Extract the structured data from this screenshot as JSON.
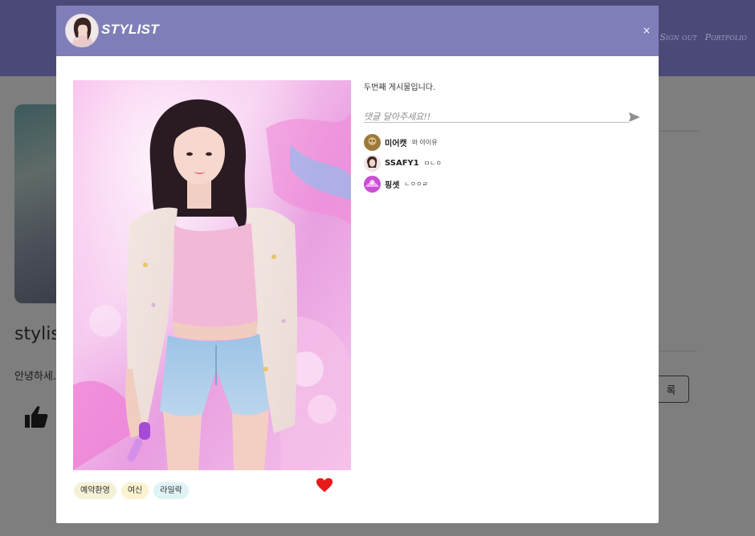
{
  "background": {
    "nav_links": [
      "Sign out",
      "Portfolio"
    ],
    "profile_name": "stylis",
    "greeting": "안녕하세.",
    "register_label": "록"
  },
  "modal": {
    "title": "STYLIST",
    "close_label": "×",
    "caption": "두번째 게시물입니다.",
    "comment_placeholder": "댓글 달아주세요!!",
    "tags": [
      {
        "label": "예약환영",
        "color": "#f4f1d6"
      },
      {
        "label": "여신",
        "color": "#fbf3cf"
      },
      {
        "label": "라일락",
        "color": "#dff3f6"
      }
    ],
    "comments": [
      {
        "user": "미어캣",
        "text": "와 아이유",
        "avatar_color": "#9a7a3c"
      },
      {
        "user": "SSAFY1",
        "text": "ㅁㄴㅇ",
        "avatar_color": "#e8ccd0"
      },
      {
        "user": "핑셋",
        "text": "ㄴㅇㅇㄹ",
        "avatar_color": "#c94fd4"
      }
    ],
    "accent_color": "#7f7eb9",
    "like_color": "#e81919"
  }
}
